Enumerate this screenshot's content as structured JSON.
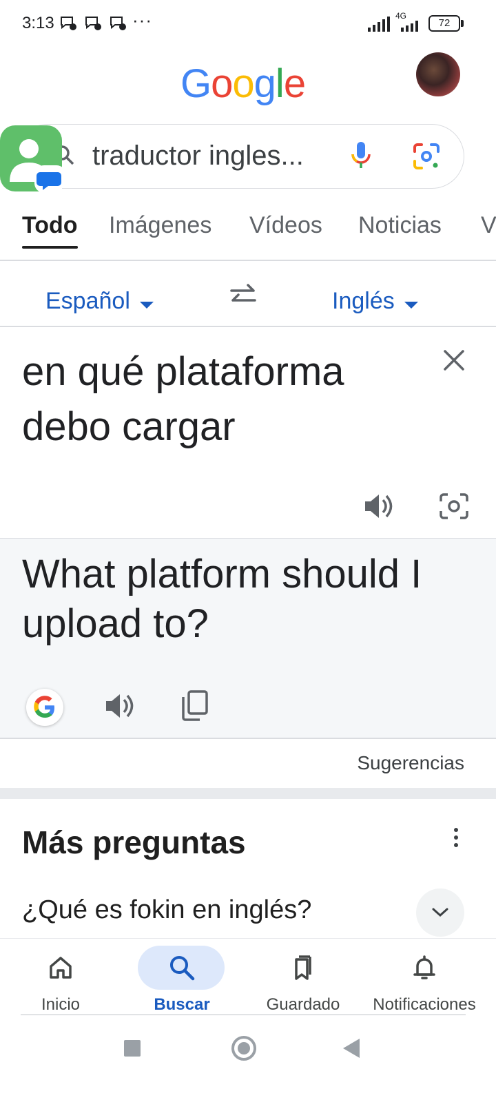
{
  "status_bar": {
    "time": "3:13",
    "more": "···",
    "network": "4G",
    "battery": "72"
  },
  "header": {
    "logo": [
      "G",
      "o",
      "o",
      "g",
      "l",
      "e"
    ],
    "logo_colors": [
      "#4285F4",
      "#EA4335",
      "#FBBC05",
      "#4285F4",
      "#34A853",
      "#EA4335"
    ]
  },
  "search": {
    "query": "traductor ingles..."
  },
  "tabs": [
    {
      "label": "Todo",
      "active": true
    },
    {
      "label": "Imágenes"
    },
    {
      "label": "Vídeos"
    },
    {
      "label": "Noticias"
    },
    {
      "label": "V"
    }
  ],
  "translator": {
    "source_lang": "Español",
    "target_lang": "Inglés",
    "source_text": "en qué plataforma debo cargar",
    "target_text": "What platform should I upload to?",
    "suggestions_label": "Sugerencias"
  },
  "more_questions": {
    "title": "Más preguntas",
    "items": [
      "¿Qué es fokin en inglés?"
    ]
  },
  "bottom_nav": [
    {
      "label": "Inicio",
      "icon": "home-icon"
    },
    {
      "label": "Buscar",
      "icon": "search-icon",
      "active": true
    },
    {
      "label": "Guardado",
      "icon": "bookmark-icon"
    },
    {
      "label": "Notificaciones",
      "icon": "bell-icon"
    }
  ],
  "colors": {
    "accent_blue": "#1a5bbf",
    "active_pill": "#dde8fb",
    "translation_bg": "#f5f7f9"
  }
}
